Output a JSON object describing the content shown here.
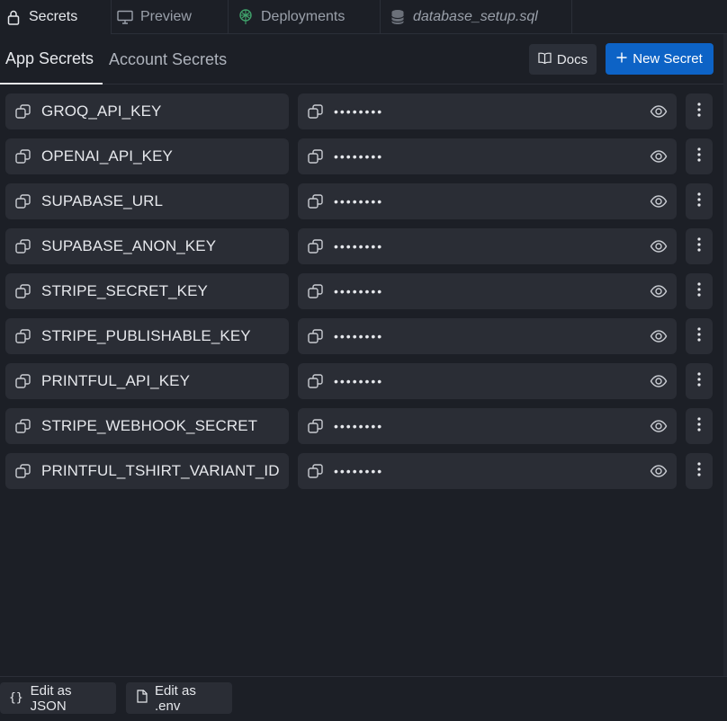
{
  "tabs": [
    {
      "label": "Secrets",
      "icon": "lock-icon"
    },
    {
      "label": "Preview",
      "icon": "monitor-icon"
    },
    {
      "label": "Deployments",
      "icon": "deploy-icon"
    },
    {
      "label": "database_setup.sql",
      "icon": "database-icon"
    }
  ],
  "subtabs": {
    "app": "App Secrets",
    "account": "Account Secrets"
  },
  "actions": {
    "docs": "Docs",
    "new_secret": "New Secret"
  },
  "secrets": [
    {
      "key": "GROQ_API_KEY",
      "value": "••••••••"
    },
    {
      "key": "OPENAI_API_KEY",
      "value": "••••••••"
    },
    {
      "key": "SUPABASE_URL",
      "value": "••••••••"
    },
    {
      "key": "SUPABASE_ANON_KEY",
      "value": "••••••••"
    },
    {
      "key": "STRIPE_SECRET_KEY",
      "value": "••••••••"
    },
    {
      "key": "STRIPE_PUBLISHABLE_KEY",
      "value": "••••••••"
    },
    {
      "key": "PRINTFUL_API_KEY",
      "value": "••••••••"
    },
    {
      "key": "STRIPE_WEBHOOK_SECRET",
      "value": "••••••••"
    },
    {
      "key": "PRINTFUL_TSHIRT_VARIANT_ID",
      "value": "••••••••"
    }
  ],
  "footer": {
    "json_icon": "{}",
    "edit_json": "Edit as JSON",
    "edit_env": "Edit as .env"
  },
  "colors": {
    "accent": "#0d63c6",
    "background": "#1c1f26",
    "field": "#2a2d35",
    "deploy_icon": "#3fa06a"
  }
}
